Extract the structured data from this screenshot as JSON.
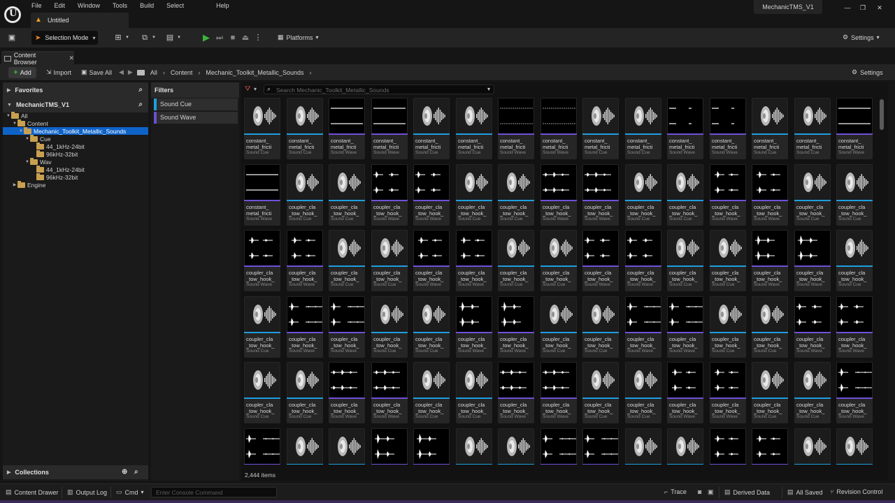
{
  "menu": [
    "File",
    "Edit",
    "Window",
    "Tools",
    "Build",
    "Select",
    "Help"
  ],
  "document_tab": "Untitled",
  "project_name": "MechanicTMS_V1",
  "toolbar": {
    "selection_mode": "Selection Mode",
    "platforms": "Platforms",
    "settings": "Settings"
  },
  "content_browser": {
    "tab_label": "Content Browser",
    "add_label": "Add",
    "import_label": "Import",
    "save_all_label": "Save All",
    "breadcrumbs": [
      "All",
      "Content",
      "Mechanic_Toolkit_Metallic_Sounds"
    ],
    "settings_label": "Settings"
  },
  "sources": {
    "favorites": "Favorites",
    "project": "MechanicTMS_V1",
    "tree": [
      {
        "label": "All",
        "depth": 0
      },
      {
        "label": "Content",
        "depth": 1
      },
      {
        "label": "Mechanic_Toolkit_Metallic_Sounds",
        "depth": 2,
        "selected": true
      },
      {
        "label": "Cue",
        "depth": 3
      },
      {
        "label": "44_1kHz-24bit",
        "depth": 4
      },
      {
        "label": "96kHz-32bit",
        "depth": 4
      },
      {
        "label": "Wav",
        "depth": 3
      },
      {
        "label": "44_1kHz-24bit",
        "depth": 4
      },
      {
        "label": "96kHz-32bit",
        "depth": 4
      },
      {
        "label": "Engine",
        "depth": 1
      }
    ],
    "collections": "Collections"
  },
  "filters": {
    "title": "Filters",
    "items": [
      {
        "label": "Sound Cue",
        "color": "#1e9ee0"
      },
      {
        "label": "Sound Wave",
        "color": "#6a4fd0"
      }
    ]
  },
  "search": {
    "placeholder": "Search Mechanic_Toolkit_Metallic_Sounds"
  },
  "asset_types": {
    "cue": {
      "label": "Sound Cue",
      "color": "#1e9ee0"
    },
    "wave": {
      "label": "Sound Wave",
      "color": "#7050d8"
    }
  },
  "asset_names": {
    "constant": [
      "constant_",
      "metal_fricti"
    ],
    "coupler": [
      "coupler_cla",
      "_tow_hook_"
    ]
  },
  "asset_rows": [
    [
      "c:constant:cue",
      "c:constant:cue",
      "w1:constant:wave",
      "w1:constant:wave",
      "c:constant:cue",
      "c:constant:cue",
      "w2:constant:wave",
      "w2:constant:wave",
      "c:constant:cue",
      "c:constant:cue",
      "w3:constant:wave",
      "w3:constant:wave",
      "c:constant:cue",
      "c:constant:cue",
      "w1:constant:wave"
    ],
    [
      "w1:constant:wave",
      "c:coupler:cue",
      "c:coupler:cue",
      "w4:coupler:wave",
      "w4:coupler:wave",
      "c:coupler:cue",
      "c:coupler:cue",
      "w5:coupler:wave",
      "w5:coupler:wave",
      "c:coupler:cue",
      "c:coupler:cue",
      "w6:coupler:wave",
      "w6:coupler:wave",
      "c:coupler:cue",
      "c:coupler:cue"
    ],
    [
      "w6:coupler:wave",
      "w6:coupler:wave",
      "c:coupler:cue",
      "c:coupler:cue",
      "w6:coupler:wave",
      "w6:coupler:wave",
      "c:coupler:cue",
      "c:coupler:cue",
      "w4:coupler:wave",
      "w4:coupler:wave",
      "c:coupler:cue",
      "c:coupler:cue",
      "w7:coupler:wave",
      "w7:coupler:wave",
      "c:coupler:cue"
    ],
    [
      "c:coupler:cue",
      "w8:coupler:wave",
      "w8:coupler:wave",
      "c:coupler:cue",
      "c:coupler:cue",
      "w7:coupler:wave",
      "w7:coupler:wave",
      "c:coupler:cue",
      "c:coupler:cue",
      "w8:coupler:wave",
      "w8:coupler:wave",
      "c:coupler:cue",
      "c:coupler:cue",
      "w4:coupler:wave",
      "w4:coupler:wave"
    ],
    [
      "c:coupler:cue",
      "c:coupler:cue",
      "w5:coupler:wave",
      "w5:coupler:wave",
      "c:coupler:cue",
      "c:coupler:cue",
      "w5:coupler:wave",
      "w5:coupler:wave",
      "c:coupler:cue",
      "c:coupler:cue",
      "w6:coupler:wave",
      "w6:coupler:wave",
      "c:coupler:cue",
      "c:coupler:cue",
      "w8:coupler:wave"
    ],
    [
      "w8:coupler:wave",
      "c:coupler:cue",
      "c:coupler:cue",
      "w7:coupler:wave",
      "w7:coupler:wave",
      "c:coupler:cue",
      "c:coupler:cue",
      "w8:coupler:wave",
      "w8:coupler:wave",
      "c:coupler:cue",
      "c:coupler:cue",
      "w6:coupler:wave",
      "w6:coupler:wave",
      "c:coupler:cue",
      "c:coupler:cue"
    ]
  ],
  "item_count": "2,444 items",
  "status": {
    "content_drawer": "Content Drawer",
    "output_log": "Output Log",
    "cmd": "Cmd",
    "console_placeholder": "Enter Console Command",
    "trace": "Trace",
    "derived_data": "Derived Data",
    "all_saved": "All Saved",
    "revision_control": "Revision Control"
  }
}
